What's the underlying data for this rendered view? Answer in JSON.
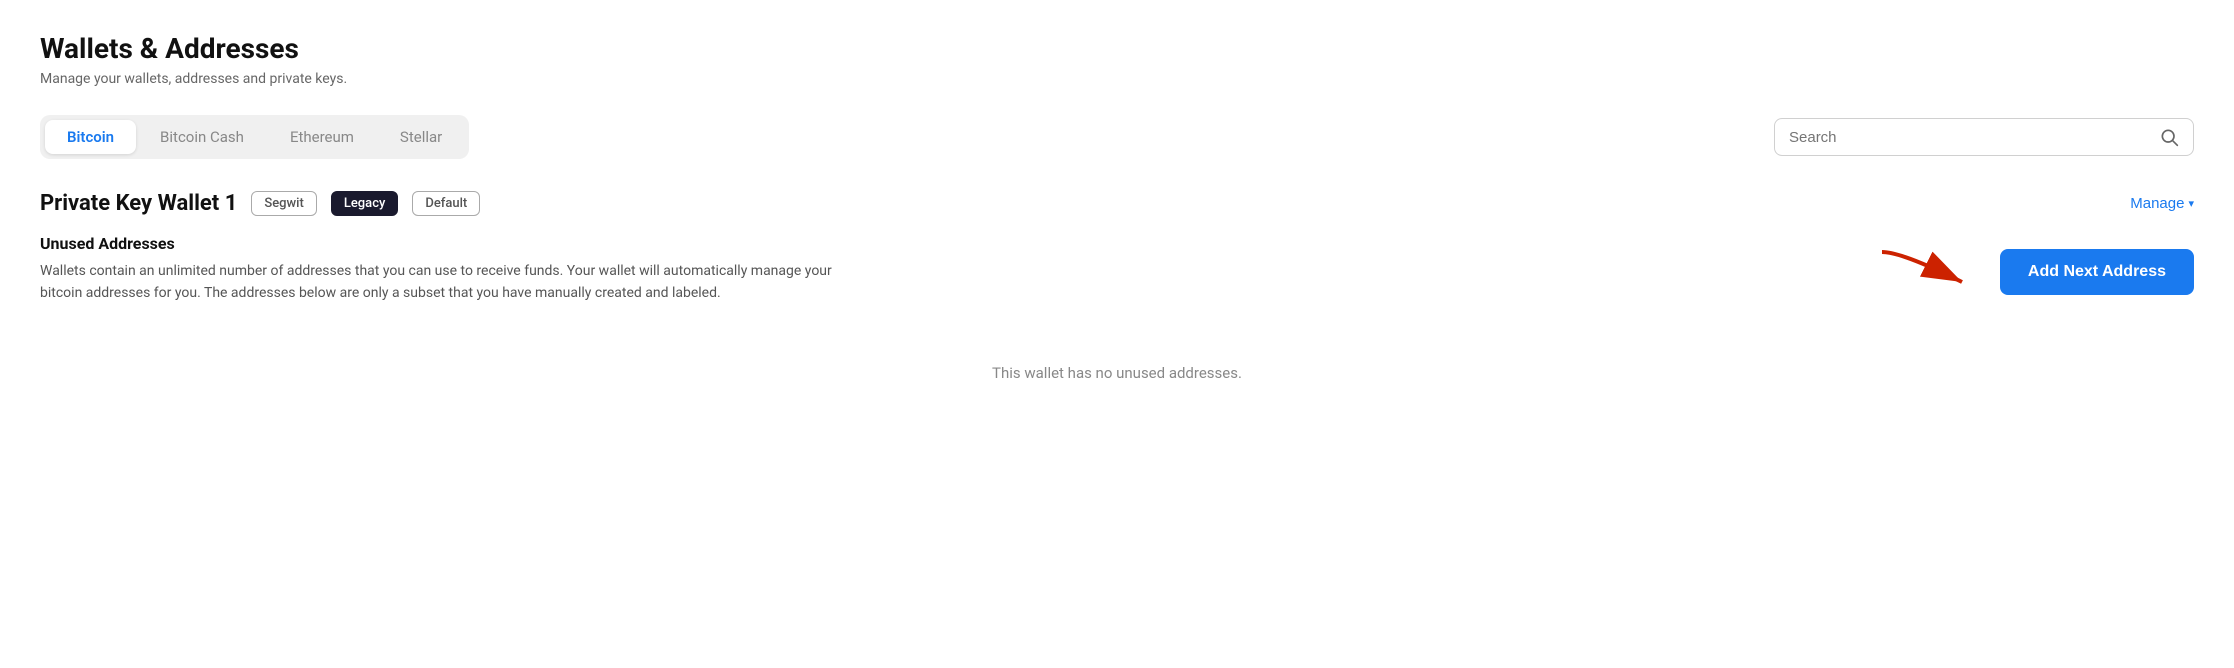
{
  "header": {
    "title": "Wallets & Addresses",
    "subtitle": "Manage your wallets, addresses and private keys."
  },
  "tabs": {
    "items": [
      {
        "label": "Bitcoin",
        "active": true
      },
      {
        "label": "Bitcoin Cash",
        "active": false
      },
      {
        "label": "Ethereum",
        "active": false
      },
      {
        "label": "Stellar",
        "active": false
      }
    ]
  },
  "search": {
    "placeholder": "Search"
  },
  "wallet": {
    "name": "Private Key Wallet 1",
    "badges": [
      {
        "label": "Segwit",
        "type": "outline"
      },
      {
        "label": "Legacy",
        "type": "filled"
      },
      {
        "label": "Default",
        "type": "outline"
      }
    ],
    "manage_label": "Manage"
  },
  "unused_addresses": {
    "title": "Unused Addresses",
    "description": "Wallets contain an unlimited number of addresses that you can use to receive funds. Your wallet will automatically manage your bitcoin addresses for you. The addresses below are only a subset that you have manually created and labeled.",
    "empty_message": "This wallet has no unused addresses.",
    "add_button_label": "Add Next Address"
  }
}
